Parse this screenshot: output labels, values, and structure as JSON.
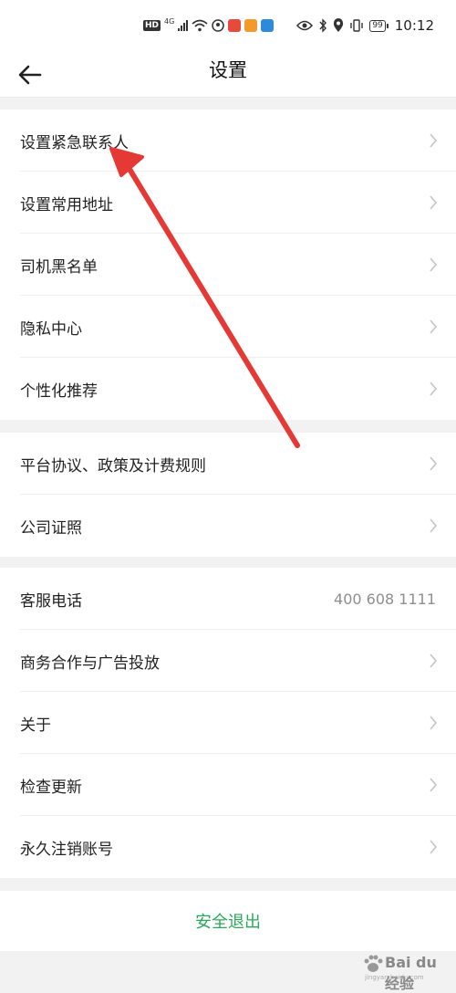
{
  "status_bar": {
    "network": "HD",
    "signal_type": "4G",
    "battery": "99",
    "time": "10:12"
  },
  "header": {
    "title": "设置",
    "back_icon": "back-arrow-icon"
  },
  "groups": [
    {
      "items": [
        {
          "label": "设置紧急联系人"
        },
        {
          "label": "设置常用地址"
        },
        {
          "label": "司机黑名单"
        },
        {
          "label": "隐私中心"
        },
        {
          "label": "个性化推荐"
        }
      ]
    },
    {
      "items": [
        {
          "label": "平台协议、政策及计费规则"
        },
        {
          "label": "公司证照"
        }
      ]
    },
    {
      "items": [
        {
          "label": "客服电话",
          "value": "400 608 1111"
        },
        {
          "label": "商务合作与广告投放"
        },
        {
          "label": "关于"
        },
        {
          "label": "检查更新"
        },
        {
          "label": "永久注销账号"
        }
      ]
    }
  ],
  "logout_label": "安全退出",
  "accent_color": "#2aa85a",
  "annotation_color": "#e53935",
  "watermark": {
    "brand": "Bai du 经验",
    "sub": "jingyan.baidu.com"
  }
}
